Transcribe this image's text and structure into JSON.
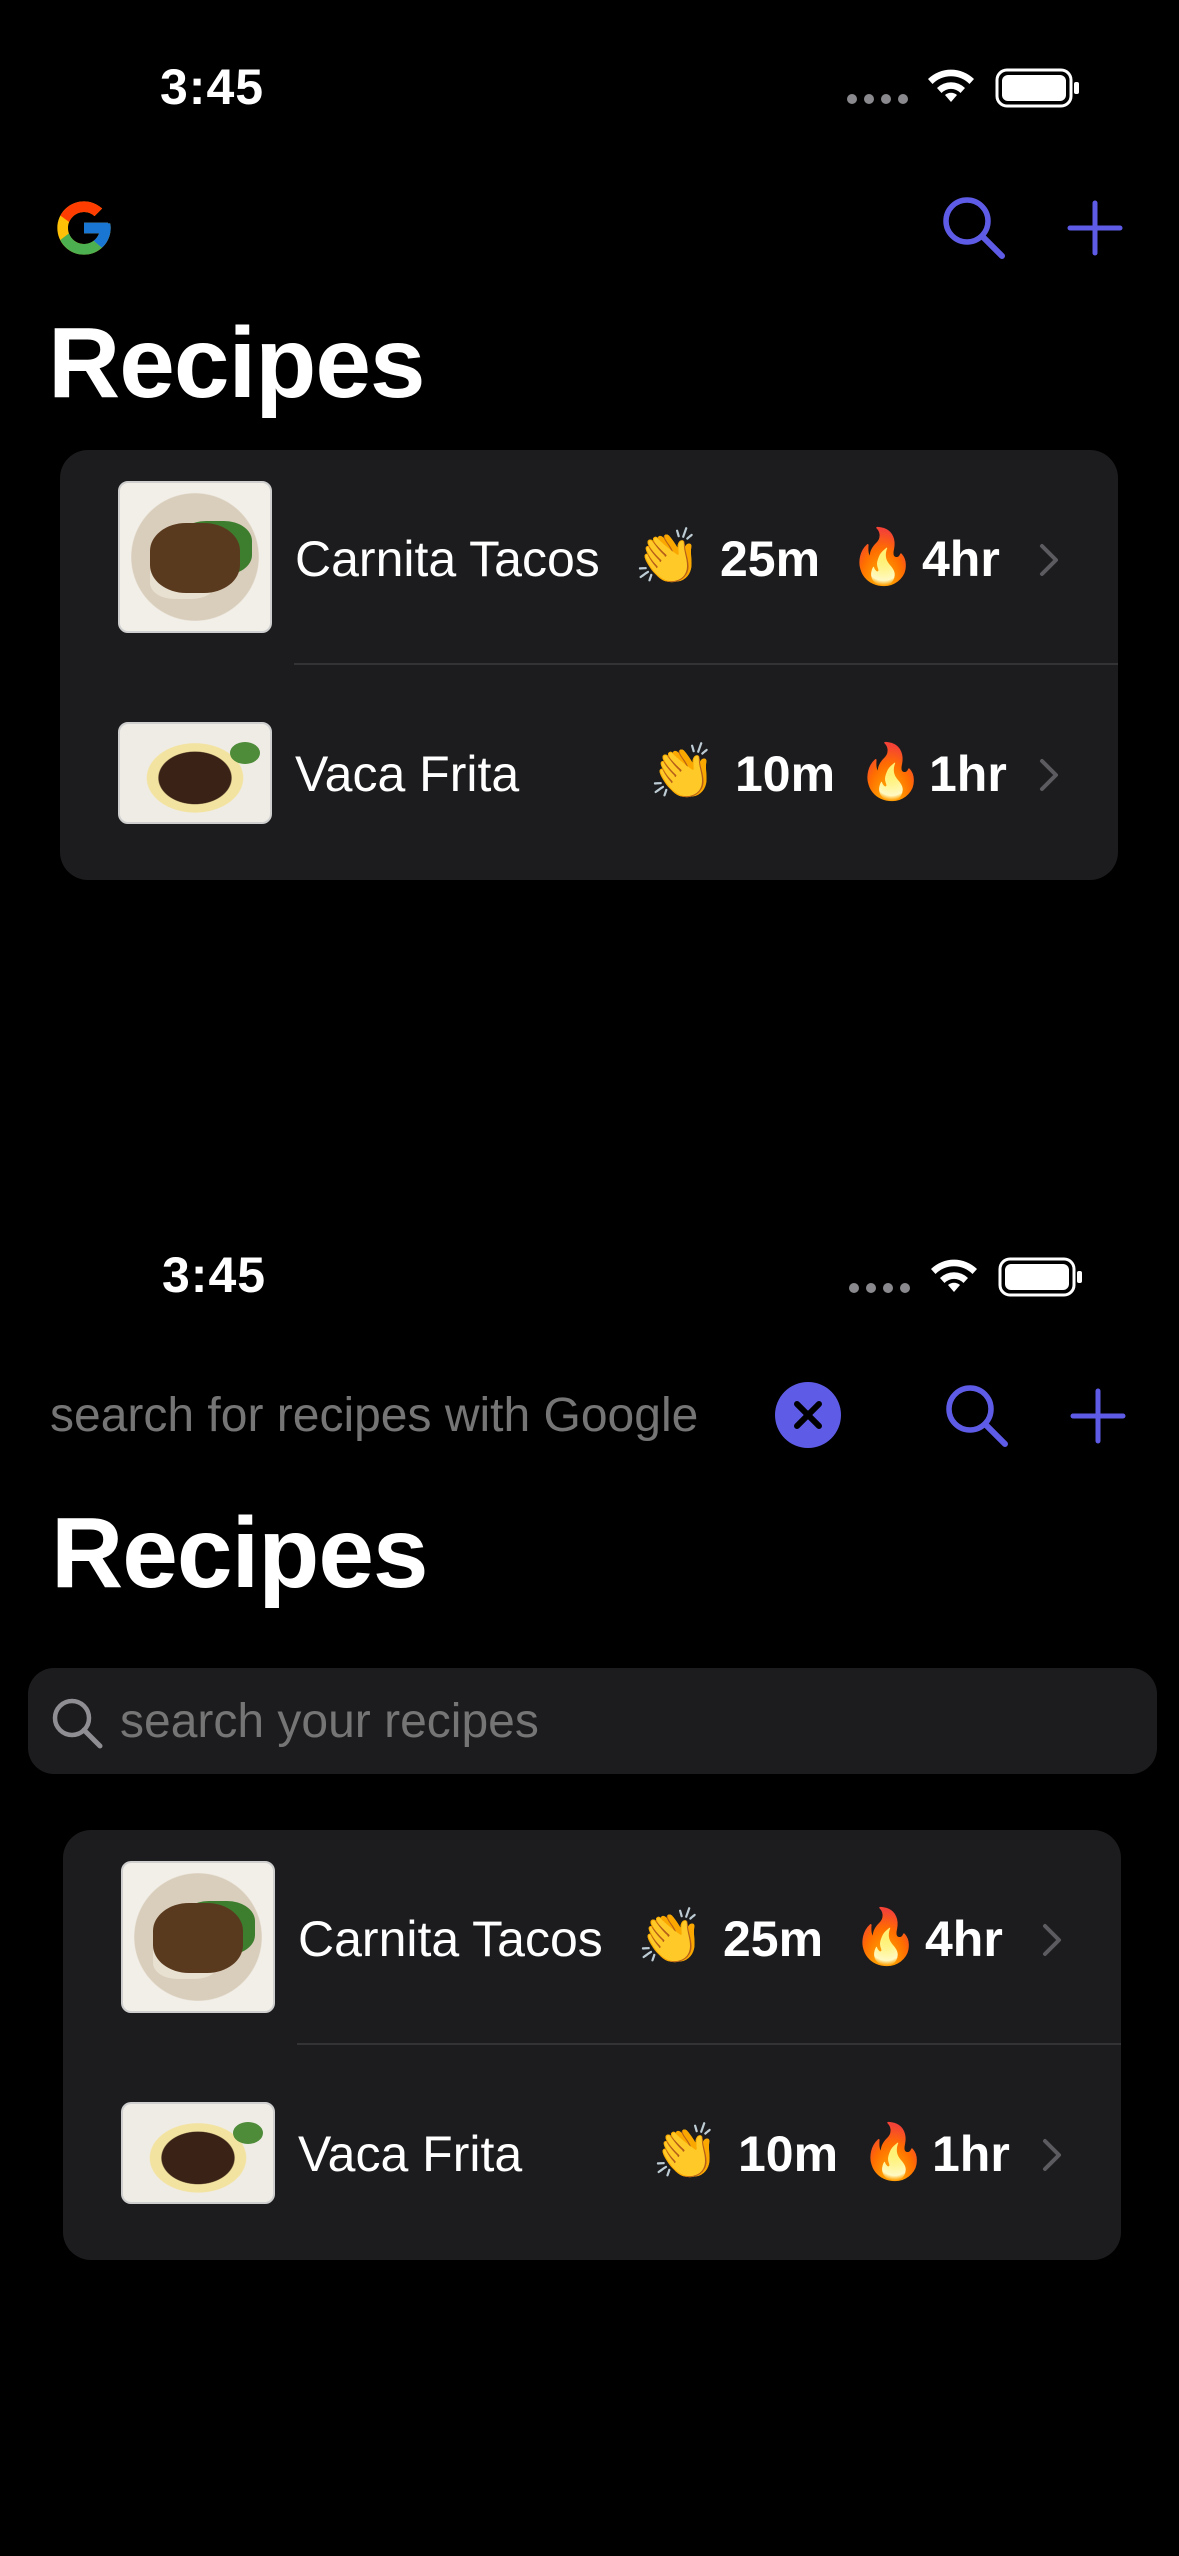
{
  "colors": {
    "accent": "#5e5ce6",
    "card": "#1c1c1e",
    "fire": "#ff3b30",
    "clap": "#f5a623"
  },
  "screen1": {
    "status_time": "3:45",
    "title": "Recipes",
    "recipes": [
      {
        "name": "Carnita Tacos",
        "prep": "25m",
        "cook": "4hr"
      },
      {
        "name": "Vaca Frita",
        "prep": "10m",
        "cook": "1hr"
      }
    ]
  },
  "screen2": {
    "status_time": "3:45",
    "google_search_placeholder": "search for recipes with Google",
    "title": "Recipes",
    "local_search_placeholder": "search your recipes",
    "recipes": [
      {
        "name": "Carnita Tacos",
        "prep": "25m",
        "cook": "4hr"
      },
      {
        "name": "Vaca Frita",
        "prep": "10m",
        "cook": "1hr"
      }
    ]
  },
  "icons": {
    "prep": "clapping-hands-emoji",
    "cook": "fire-emoji",
    "glyph_prep": "👏",
    "glyph_cook": "🔥"
  }
}
